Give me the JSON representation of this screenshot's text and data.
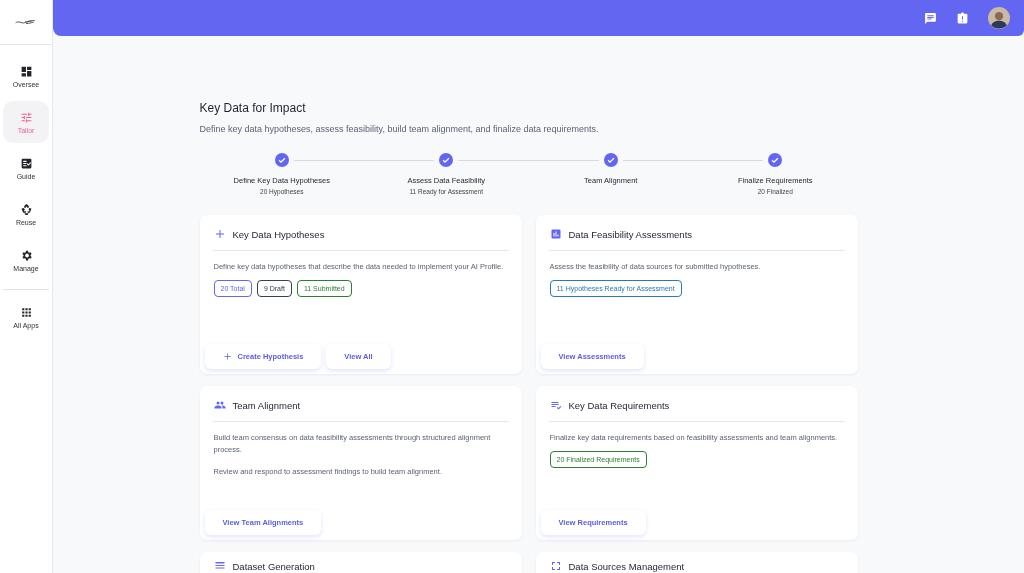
{
  "sidebar": {
    "items": [
      {
        "label": "Oversee",
        "selected": false
      },
      {
        "label": "Tailor",
        "selected": true
      },
      {
        "label": "Guide",
        "selected": false
      },
      {
        "label": "Reuse",
        "selected": false
      },
      {
        "label": "Manage",
        "selected": false
      }
    ],
    "footer": {
      "label": "All Apps"
    }
  },
  "page": {
    "title": "Key Data for Impact",
    "subtitle": "Define key data hypotheses, assess feasibility, build team alignment, and finalize data requirements."
  },
  "steps": [
    {
      "label": "Define Key Data Hypotheses",
      "detail": "20 Hypotheses",
      "completed": true
    },
    {
      "label": "Assess Data Feasibility",
      "detail": "11 Ready for Assessment",
      "completed": true
    },
    {
      "label": "Team Alignment",
      "completed": true
    },
    {
      "label": "Finalize Requirements",
      "detail": "20 Finalized",
      "completed": true
    }
  ],
  "cards": [
    {
      "title": "Key Data Hypotheses",
      "descriptions": [
        "Define key data hypotheses that describe the data needed to implement your AI Profile."
      ],
      "badges": [
        {
          "text": "20 Total",
          "color": "#6366f1"
        },
        {
          "text": "9 Draft",
          "color": "#374151"
        },
        {
          "text": "11 Submitted",
          "color": "#2e7d32"
        }
      ],
      "buttons": [
        {
          "label": "Create Hypothesis",
          "kind": "create"
        },
        {
          "label": "View All",
          "kind": "view"
        }
      ]
    },
    {
      "title": "Data Feasibility Assessments",
      "descriptions": [
        "Assess the feasibility of data sources for submitted hypotheses."
      ],
      "badges": [
        {
          "text": "11 Hypotheses Ready for Assessment",
          "color": "#2a7ab0"
        }
      ],
      "buttons": [
        {
          "label": "View Assessments",
          "kind": "view"
        }
      ]
    },
    {
      "title": "Team Alignment",
      "descriptions": [
        "Build team consensus on data feasibility assessments through structured alignment process.",
        "Review and respond to assessment findings to build team alignment."
      ],
      "buttons": [
        {
          "label": "View Team Alignments",
          "kind": "view"
        }
      ]
    },
    {
      "title": "Key Data Requirements",
      "descriptions": [
        "Finalize key data requirements based on feasibility assessments and team alignments."
      ],
      "badges": [
        {
          "text": "20 Finalized Requirements",
          "color": "#2e7d32"
        }
      ],
      "buttons": [
        {
          "label": "View Requirements",
          "kind": "view"
        }
      ]
    },
    {
      "title": "Dataset Generation"
    },
    {
      "title": "Data Sources Management"
    }
  ]
}
